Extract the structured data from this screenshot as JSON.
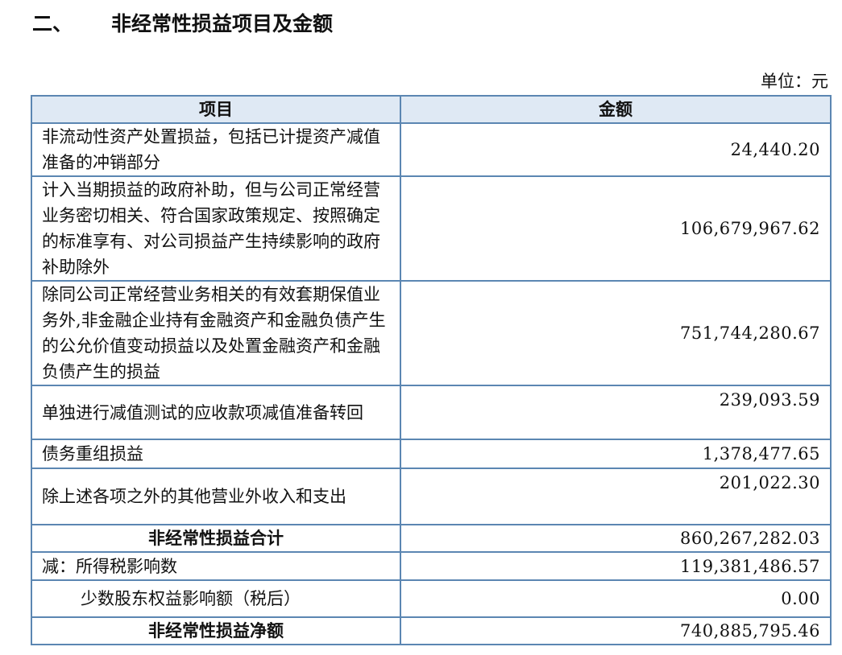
{
  "section": {
    "number": "二、",
    "title": "非经常性损益项目及金额"
  },
  "unit_label": "单位：元",
  "table": {
    "headers": [
      "项目",
      "金额"
    ],
    "rows": [
      {
        "item": "非流动性资产处置损益，包括已计提资产减值准备的冲销部分",
        "amount": "24,440.20"
      },
      {
        "item": "计入当期损益的政府补助，但与公司正常经营业务密切相关、符合国家政策规定、按照确定的标准享有、对公司损益产生持续影响的政府补助除外",
        "amount": "106,679,967.62"
      },
      {
        "item": "除同公司正常经营业务相关的有效套期保值业务外,非金融企业持有金融资产和金融负债产生的公允价值变动损益以及处置金融资产和金融负债产生的损益",
        "amount": "751,744,280.67"
      },
      {
        "item": "单独进行减值测试的应收款项减值准备转回",
        "amount": "239,093.59"
      },
      {
        "item": "债务重组损益",
        "amount": "1,378,477.65"
      },
      {
        "item": "除上述各项之外的其他营业外收入和支出",
        "amount": "201,022.30"
      }
    ],
    "subtotal": {
      "item": "非经常性损益合计",
      "amount": "860,267,282.03"
    },
    "less_tax": {
      "item": "减：所得税影响数",
      "amount": "119,381,486.57"
    },
    "less_minority": {
      "item": "少数股东权益影响额（税后）",
      "amount": "0.00"
    },
    "net": {
      "item": "非经常性损益净额",
      "amount": "740,885,795.46"
    }
  }
}
